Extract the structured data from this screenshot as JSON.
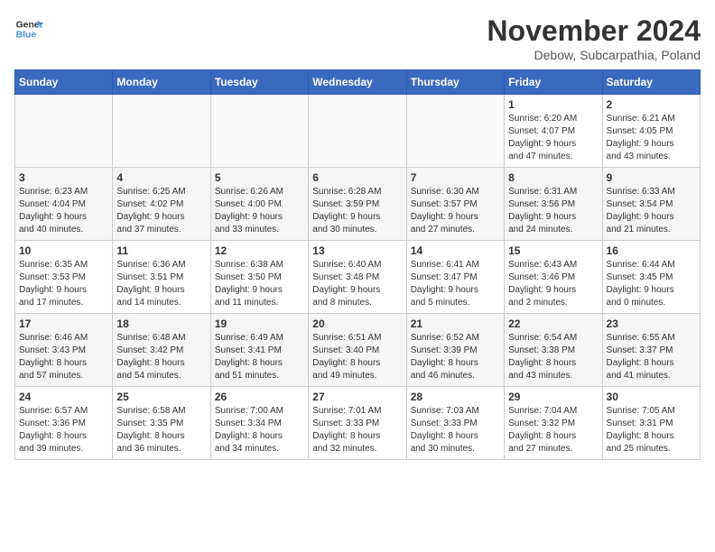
{
  "logo": {
    "line1": "General",
    "line2": "Blue"
  },
  "title": "November 2024",
  "location": "Debow, Subcarpathia, Poland",
  "days_of_week": [
    "Sunday",
    "Monday",
    "Tuesday",
    "Wednesday",
    "Thursday",
    "Friday",
    "Saturday"
  ],
  "weeks": [
    [
      {
        "day": "",
        "detail": ""
      },
      {
        "day": "",
        "detail": ""
      },
      {
        "day": "",
        "detail": ""
      },
      {
        "day": "",
        "detail": ""
      },
      {
        "day": "",
        "detail": ""
      },
      {
        "day": "1",
        "detail": "Sunrise: 6:20 AM\nSunset: 4:07 PM\nDaylight: 9 hours\nand 47 minutes."
      },
      {
        "day": "2",
        "detail": "Sunrise: 6:21 AM\nSunset: 4:05 PM\nDaylight: 9 hours\nand 43 minutes."
      }
    ],
    [
      {
        "day": "3",
        "detail": "Sunrise: 6:23 AM\nSunset: 4:04 PM\nDaylight: 9 hours\nand 40 minutes."
      },
      {
        "day": "4",
        "detail": "Sunrise: 6:25 AM\nSunset: 4:02 PM\nDaylight: 9 hours\nand 37 minutes."
      },
      {
        "day": "5",
        "detail": "Sunrise: 6:26 AM\nSunset: 4:00 PM\nDaylight: 9 hours\nand 33 minutes."
      },
      {
        "day": "6",
        "detail": "Sunrise: 6:28 AM\nSunset: 3:59 PM\nDaylight: 9 hours\nand 30 minutes."
      },
      {
        "day": "7",
        "detail": "Sunrise: 6:30 AM\nSunset: 3:57 PM\nDaylight: 9 hours\nand 27 minutes."
      },
      {
        "day": "8",
        "detail": "Sunrise: 6:31 AM\nSunset: 3:56 PM\nDaylight: 9 hours\nand 24 minutes."
      },
      {
        "day": "9",
        "detail": "Sunrise: 6:33 AM\nSunset: 3:54 PM\nDaylight: 9 hours\nand 21 minutes."
      }
    ],
    [
      {
        "day": "10",
        "detail": "Sunrise: 6:35 AM\nSunset: 3:53 PM\nDaylight: 9 hours\nand 17 minutes."
      },
      {
        "day": "11",
        "detail": "Sunrise: 6:36 AM\nSunset: 3:51 PM\nDaylight: 9 hours\nand 14 minutes."
      },
      {
        "day": "12",
        "detail": "Sunrise: 6:38 AM\nSunset: 3:50 PM\nDaylight: 9 hours\nand 11 minutes."
      },
      {
        "day": "13",
        "detail": "Sunrise: 6:40 AM\nSunset: 3:48 PM\nDaylight: 9 hours\nand 8 minutes."
      },
      {
        "day": "14",
        "detail": "Sunrise: 6:41 AM\nSunset: 3:47 PM\nDaylight: 9 hours\nand 5 minutes."
      },
      {
        "day": "15",
        "detail": "Sunrise: 6:43 AM\nSunset: 3:46 PM\nDaylight: 9 hours\nand 2 minutes."
      },
      {
        "day": "16",
        "detail": "Sunrise: 6:44 AM\nSunset: 3:45 PM\nDaylight: 9 hours\nand 0 minutes."
      }
    ],
    [
      {
        "day": "17",
        "detail": "Sunrise: 6:46 AM\nSunset: 3:43 PM\nDaylight: 8 hours\nand 57 minutes."
      },
      {
        "day": "18",
        "detail": "Sunrise: 6:48 AM\nSunset: 3:42 PM\nDaylight: 8 hours\nand 54 minutes."
      },
      {
        "day": "19",
        "detail": "Sunrise: 6:49 AM\nSunset: 3:41 PM\nDaylight: 8 hours\nand 51 minutes."
      },
      {
        "day": "20",
        "detail": "Sunrise: 6:51 AM\nSunset: 3:40 PM\nDaylight: 8 hours\nand 49 minutes."
      },
      {
        "day": "21",
        "detail": "Sunrise: 6:52 AM\nSunset: 3:39 PM\nDaylight: 8 hours\nand 46 minutes."
      },
      {
        "day": "22",
        "detail": "Sunrise: 6:54 AM\nSunset: 3:38 PM\nDaylight: 8 hours\nand 43 minutes."
      },
      {
        "day": "23",
        "detail": "Sunrise: 6:55 AM\nSunset: 3:37 PM\nDaylight: 8 hours\nand 41 minutes."
      }
    ],
    [
      {
        "day": "24",
        "detail": "Sunrise: 6:57 AM\nSunset: 3:36 PM\nDaylight: 8 hours\nand 39 minutes."
      },
      {
        "day": "25",
        "detail": "Sunrise: 6:58 AM\nSunset: 3:35 PM\nDaylight: 8 hours\nand 36 minutes."
      },
      {
        "day": "26",
        "detail": "Sunrise: 7:00 AM\nSunset: 3:34 PM\nDaylight: 8 hours\nand 34 minutes."
      },
      {
        "day": "27",
        "detail": "Sunrise: 7:01 AM\nSunset: 3:33 PM\nDaylight: 8 hours\nand 32 minutes."
      },
      {
        "day": "28",
        "detail": "Sunrise: 7:03 AM\nSunset: 3:33 PM\nDaylight: 8 hours\nand 30 minutes."
      },
      {
        "day": "29",
        "detail": "Sunrise: 7:04 AM\nSunset: 3:32 PM\nDaylight: 8 hours\nand 27 minutes."
      },
      {
        "day": "30",
        "detail": "Sunrise: 7:05 AM\nSunset: 3:31 PM\nDaylight: 8 hours\nand 25 minutes."
      }
    ]
  ]
}
